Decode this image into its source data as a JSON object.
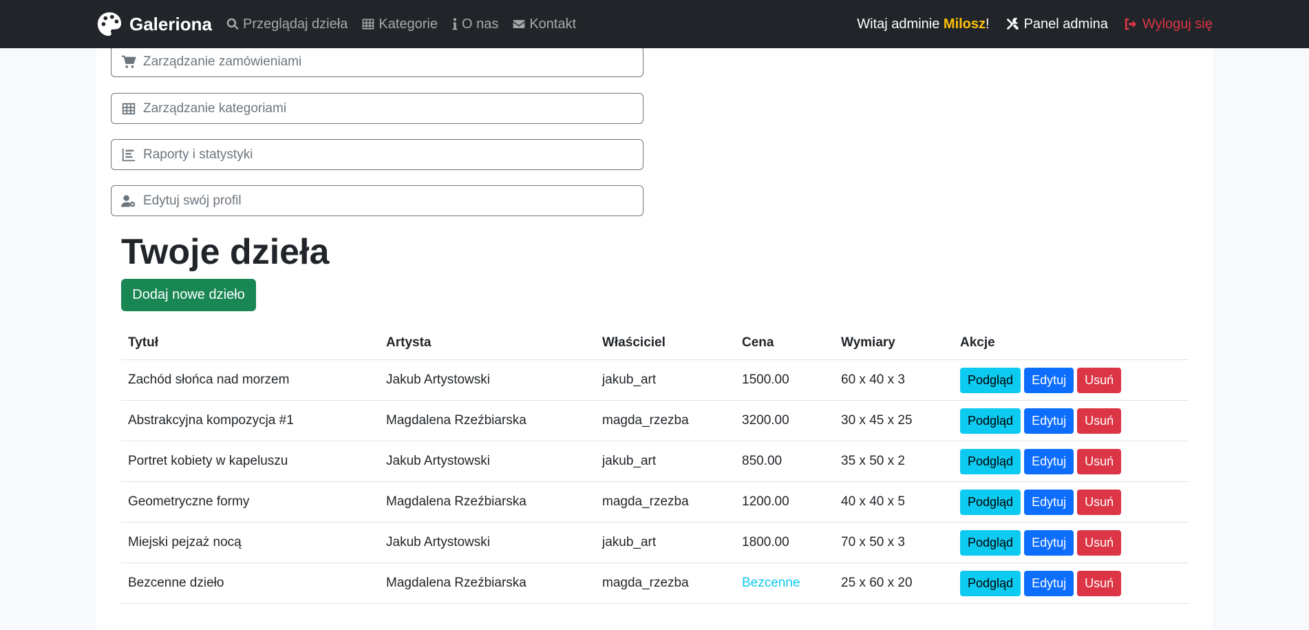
{
  "navbar": {
    "brand": "Galeriona",
    "links": [
      {
        "label": "Przeglądaj dzieła",
        "icon": "search-icon"
      },
      {
        "label": "Kategorie",
        "icon": "table-icon"
      },
      {
        "label": "O nas",
        "icon": "info-icon"
      },
      {
        "label": "Kontakt",
        "icon": "envelope-icon"
      }
    ],
    "welcome_prefix": "Witaj adminie ",
    "username": "Milosz",
    "welcome_suffix": "!",
    "admin_label": "Panel admina",
    "logout_label": "Wyloguj się"
  },
  "admin_menu": [
    {
      "label": "Zarządzanie zamówieniami",
      "icon": "cart-icon"
    },
    {
      "label": "Zarządzanie kategoriami",
      "icon": "table-icon"
    },
    {
      "label": "Raporty i statystyki",
      "icon": "chart-icon"
    },
    {
      "label": "Edytuj swój profil",
      "icon": "user-gear-icon"
    }
  ],
  "works": {
    "title": "Twoje dzieła",
    "add_button": "Dodaj nowe dzieło",
    "columns": [
      "Tytuł",
      "Artysta",
      "Właściciel",
      "Cena",
      "Wymiary",
      "Akcje"
    ],
    "rows": [
      {
        "title": "Zachód słońca nad morzem",
        "artist": "Jakub Artystowski",
        "owner": "jakub_art",
        "price": "1500.00",
        "dims": "60 x 40 x 3"
      },
      {
        "title": "Abstrakcyjna kompozycja #1",
        "artist": "Magdalena Rzeźbiarska",
        "owner": "magda_rzezba",
        "price": "3200.00",
        "dims": "30 x 45 x 25"
      },
      {
        "title": "Portret kobiety w kapeluszu",
        "artist": "Jakub Artystowski",
        "owner": "jakub_art",
        "price": "850.00",
        "dims": "35 x 50 x 2"
      },
      {
        "title": "Geometryczne formy",
        "artist": "Magdalena Rzeźbiarska",
        "owner": "magda_rzezba",
        "price": "1200.00",
        "dims": "40 x 40 x 5"
      },
      {
        "title": "Miejski pejzaż nocą",
        "artist": "Jakub Artystowski",
        "owner": "jakub_art",
        "price": "1800.00",
        "dims": "70 x 50 x 3"
      },
      {
        "title": "Bezcenne dzieło",
        "artist": "Magdalena Rzeźbiarska",
        "owner": "magda_rzezba",
        "price": "Bezcenne",
        "dims": "25 x 60 x 20"
      }
    ],
    "actions": {
      "view": "Podgląd",
      "edit": "Edytuj",
      "delete": "Usuń"
    }
  },
  "colors": {
    "navbar_bg": "#212529",
    "username": "#ffc107",
    "logout": "#dc3545",
    "add_button": "#198754",
    "view_button": "#0dcaf0",
    "edit_button": "#0d6efd",
    "delete_button": "#dc3545"
  }
}
